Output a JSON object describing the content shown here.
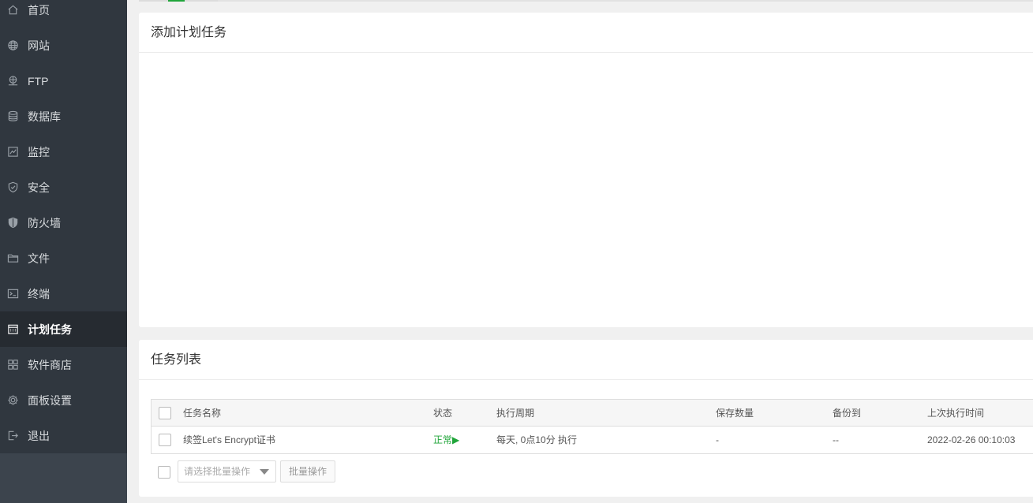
{
  "sidebar": {
    "items": [
      {
        "label": "首页",
        "icon": "home-icon"
      },
      {
        "label": "网站",
        "icon": "globe-icon"
      },
      {
        "label": "FTP",
        "icon": "ftp-icon"
      },
      {
        "label": "数据库",
        "icon": "database-icon"
      },
      {
        "label": "监控",
        "icon": "monitor-icon"
      },
      {
        "label": "安全",
        "icon": "shield-check-icon"
      },
      {
        "label": "防火墙",
        "icon": "firewall-shield-icon"
      },
      {
        "label": "文件",
        "icon": "folder-icon"
      },
      {
        "label": "终端",
        "icon": "terminal-icon"
      },
      {
        "label": "计划任务",
        "icon": "calendar-icon",
        "active": true
      },
      {
        "label": "软件商店",
        "icon": "apps-grid-icon"
      },
      {
        "label": "面板设置",
        "icon": "gear-icon"
      },
      {
        "label": "退出",
        "icon": "logout-icon"
      }
    ]
  },
  "add_panel": {
    "title": "添加计划任务"
  },
  "list_panel": {
    "title": "任务列表",
    "columns": [
      "任务名称",
      "状态",
      "执行周期",
      "保存数量",
      "备份到",
      "上次执行时间"
    ],
    "rows": [
      {
        "name": "续签Let's Encrypt证书",
        "status": "正常▶",
        "cycle": "每天, 0点10分 执行",
        "save_count": "-",
        "backup_to": "--",
        "last_run": "2022-02-26 00:10:03"
      }
    ],
    "batch_select_placeholder": "请选择批量操作",
    "batch_button": "批量操作"
  },
  "colors": {
    "sidebar_bg": "#30373f",
    "sidebar_active": "#262b31",
    "accent_green": "#20a53a"
  }
}
